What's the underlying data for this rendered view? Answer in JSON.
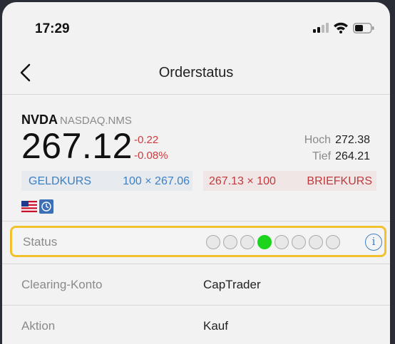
{
  "statusbar": {
    "time": "17:29"
  },
  "header": {
    "title": "Orderstatus"
  },
  "quote": {
    "ticker": "NVDA",
    "exchange": "NASDAQ.NMS",
    "price": "267.12",
    "change_abs": "-0.22",
    "change_pct": "-0.08%",
    "high_label": "Hoch",
    "high_value": "272.38",
    "low_label": "Tief",
    "low_value": "264.21",
    "bid_label": "GELDKURS",
    "bid_value": "100 × 267.06",
    "ask_value": "267.13 × 100",
    "ask_label": "BRIEFKURS"
  },
  "order_status": {
    "label": "Status",
    "steps_total": 8,
    "active_step": 4,
    "info_glyph": "i"
  },
  "details": [
    {
      "label": "Clearing-Konto",
      "value": "CapTrader"
    },
    {
      "label": "Aktion",
      "value": "Kauf"
    }
  ],
  "colors": {
    "accent_blue": "#3c80c4",
    "negative_red": "#d0393c",
    "active_green": "#1bd41b",
    "highlight_border": "#f2c12e"
  }
}
